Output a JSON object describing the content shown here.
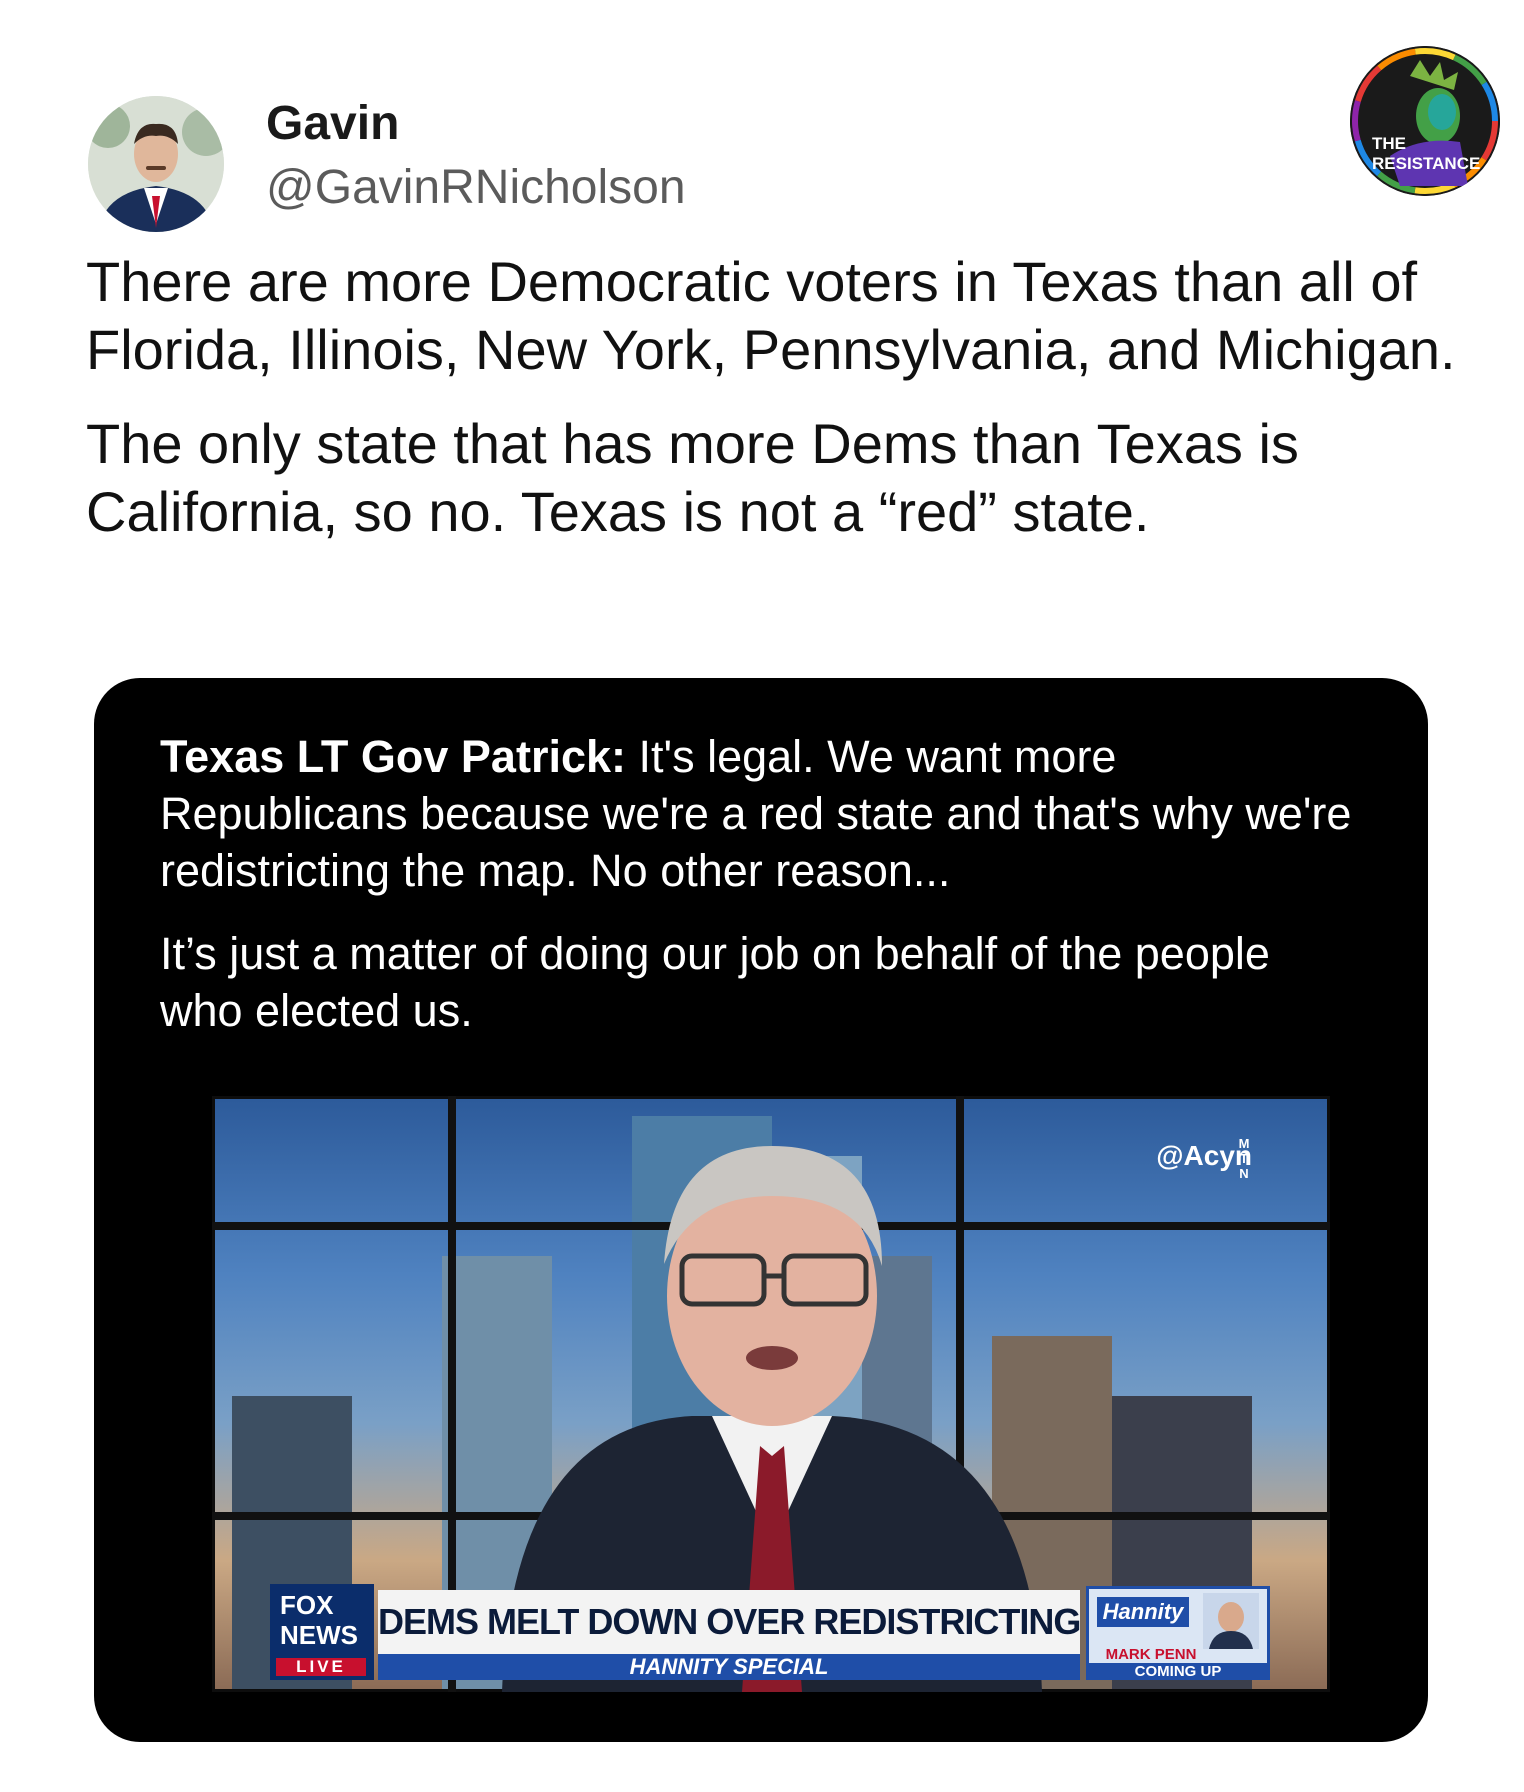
{
  "author": {
    "name": "Gavin",
    "handle": "@GavinRNicholson"
  },
  "badge": {
    "line1": "THE",
    "line2": "RESISTANCE"
  },
  "tweet": {
    "paragraphs": [
      "There are more Democratic voters in Texas than all of Florida, Illinois, New York, Pennsylvania, and Michigan.",
      "The only state that has more Dems than Texas is California, so no. Texas is not a “red” state."
    ]
  },
  "card": {
    "speaker": "Texas LT Gov Patrick:",
    "quote_line1": " It's legal. We want more Republicans because we're a red state and that's why we're redistricting the map. No other reason...",
    "quote_line2": "It’s just a matter of doing our job on behalf of the people who elected us."
  },
  "video": {
    "watermark": "@Acyn",
    "network_logo_line1": "FOX",
    "network_logo_line2": "NEWS",
    "live_label": "LIVE",
    "headline": "DEMS MELT DOWN OVER REDISTRICTING FIGHT",
    "subheadline": "HANNITY SPECIAL",
    "show_logo": "Hannity",
    "upcoming_guest": "MARK PENN",
    "upcoming_label": "COMING UP",
    "corner_letters": [
      "M",
      "T",
      "N"
    ]
  }
}
